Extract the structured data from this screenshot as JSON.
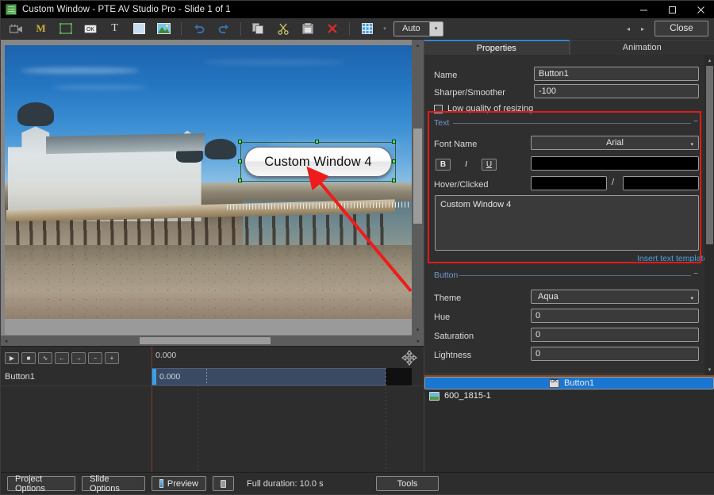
{
  "window": {
    "title": "Custom Window - PTE AV Studio Pro - Slide 1 of 1",
    "app_icon": "app-icon",
    "minimize": "─",
    "maximize": "□",
    "close": "✕"
  },
  "toolbar": {
    "items": [
      {
        "name": "video-clip-icon",
        "glyph": "video"
      },
      {
        "name": "mask-icon",
        "glyph": "M"
      },
      {
        "name": "frame-icon",
        "glyph": "frame"
      },
      {
        "name": "button-object-icon",
        "glyph": "OK"
      },
      {
        "name": "text-object-icon",
        "glyph": "T"
      },
      {
        "name": "rectangle-object-icon",
        "glyph": "rect"
      },
      {
        "name": "image-object-icon",
        "glyph": "image"
      }
    ],
    "undo": "undo-icon",
    "redo": "redo-icon",
    "copy": "copy-icon",
    "cut": "cut-icon",
    "paste": "paste-icon",
    "delete": "delete-icon",
    "grid": "grid-icon",
    "grid_caret": "▾",
    "zoom_value": "Auto",
    "zoom_caret": "▾",
    "prev_slide": "◂",
    "next_slide": "▸",
    "close_label": "Close"
  },
  "canvas": {
    "object_label": "Custom Window 4",
    "scroll_v": "vertical-scrollbar",
    "scroll_h": "horizontal-scrollbar",
    "arrow_up": "▴",
    "arrow_down": "▾",
    "arrow_left": "◂",
    "arrow_right": "▸"
  },
  "timeline": {
    "buttons": [
      {
        "name": "play-button",
        "glyph": "▶"
      },
      {
        "name": "stop-button",
        "glyph": "■"
      },
      {
        "name": "waveform-button",
        "glyph": "∿"
      },
      {
        "name": "previous-keyframe-button",
        "glyph": "←"
      },
      {
        "name": "next-keyframe-button",
        "glyph": "→"
      },
      {
        "name": "zoom-out-button",
        "glyph": "−"
      },
      {
        "name": "zoom-in-button",
        "glyph": "+"
      }
    ],
    "ruler_start": "0.000",
    "track_name": "Button1",
    "track_time": "0.000",
    "pan_tool": "pan-tool-icon"
  },
  "properties": {
    "tabs": [
      {
        "label": "Properties",
        "active": true
      },
      {
        "label": "Animation",
        "active": false
      }
    ],
    "name_label": "Name",
    "name_value": "Button1",
    "sharper_label": "Sharper/Smoother",
    "sharper_value": "-100",
    "low_quality_label": "Low quality of resizing",
    "text_group": "Text",
    "font_name_label": "Font Name",
    "font_name_value": "Arial",
    "style_bold": "B",
    "style_italic": "I",
    "style_underline": "U",
    "text_color_value": "",
    "hover_clicked_label": "Hover/Clicked",
    "hover_value": "",
    "clicked_value": "",
    "hover_separator": "/",
    "text_content": "Custom Window 4",
    "insert_text_template": "Insert text template",
    "button_group": "Button",
    "theme_label": "Theme",
    "theme_value": "Aqua",
    "hue_label": "Hue",
    "hue_value": "0",
    "saturation_label": "Saturation",
    "saturation_value": "0",
    "lightness_label": "Lightness",
    "lightness_value": "0",
    "collapse_glyph": "−",
    "caret": "▾",
    "highlight_color": "#e01b1b"
  },
  "objects": {
    "items": [
      {
        "name": "Button1",
        "icon": "button-icon",
        "selected": true
      },
      {
        "name": "600_1815-1",
        "icon": "image-icon",
        "selected": false
      }
    ]
  },
  "bottom": {
    "project_options": "Project Options",
    "slide_options": "Slide Options",
    "preview": "Preview",
    "fullscreen": "fullscreen-icon",
    "duration": "Full duration: 10.0 s",
    "tools": "Tools"
  }
}
